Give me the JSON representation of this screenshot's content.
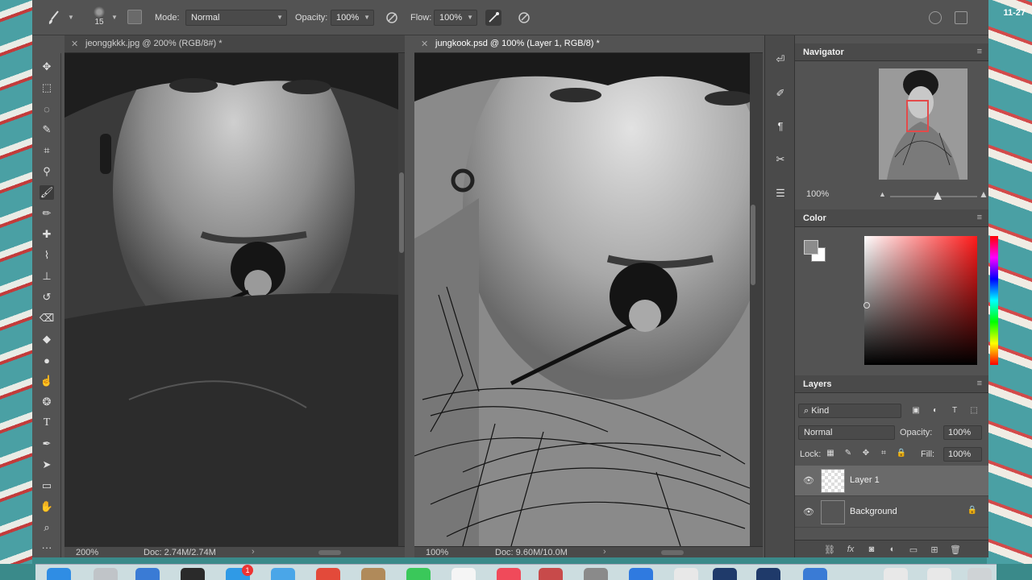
{
  "system": {
    "date_fragment": "11-27"
  },
  "options_bar": {
    "brush_size": "15",
    "mode_label": "Mode:",
    "mode_value": "Normal",
    "opacity_label": "Opacity:",
    "opacity_value": "100%",
    "flow_label": "Flow:",
    "flow_value": "100%"
  },
  "tools": [
    "move-tool",
    "marquee-tool",
    "lasso-tool",
    "quick-select-tool",
    "crop-tool",
    "eyedropper-tool",
    "brush-tool",
    "pencil-tool",
    "healing-tool",
    "mixer-brush-tool",
    "stamp-tool",
    "history-brush-tool",
    "eraser-tool",
    "bucket-tool",
    "blur-tool",
    "smudge-tool",
    "sponge-tool",
    "type-tool",
    "pen-tool",
    "path-select-tool",
    "rectangle-tool",
    "hand-tool",
    "zoom-tool",
    "more-tools"
  ],
  "documents": [
    {
      "title": "jeonggkkk.jpg @ 200% (RGB/8#) *",
      "zoom": "200%",
      "doc_info": "Doc: 2.74M/2.74M"
    },
    {
      "title": "jungkook.psd @ 100% (Layer 1, RGB/8) *",
      "zoom": "100%",
      "doc_info": "Doc: 9.60M/10.0M"
    }
  ],
  "navigator": {
    "title": "Navigator",
    "zoom": "100%"
  },
  "color_panel": {
    "title": "Color",
    "foreground": "#8c8c8c",
    "background": "#ffffff"
  },
  "layers_panel": {
    "title": "Layers",
    "filter_kind": "Kind",
    "blend_mode": "Normal",
    "opacity_label": "Opacity:",
    "opacity_value": "100%",
    "lock_label": "Lock:",
    "fill_label": "Fill:",
    "fill_value": "100%",
    "layers": [
      {
        "name": "Layer 1",
        "selected": true,
        "locked": false
      },
      {
        "name": "Background",
        "selected": false,
        "locked": true
      }
    ]
  }
}
